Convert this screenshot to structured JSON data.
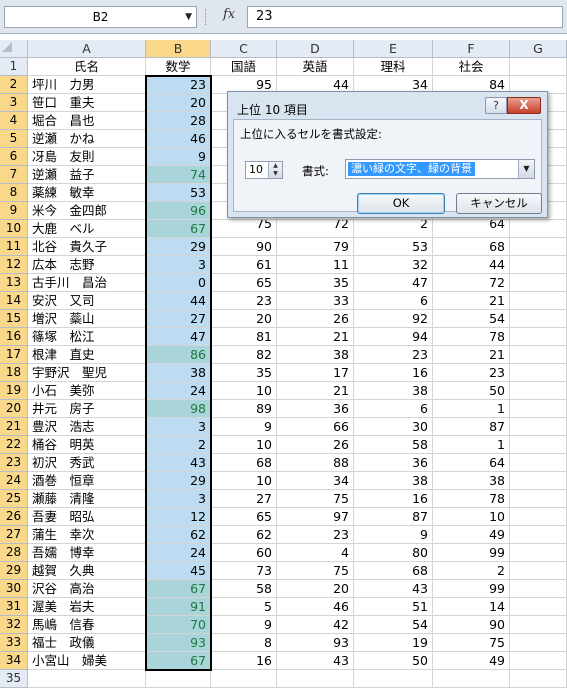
{
  "formula_bar": {
    "name_box": "B2",
    "fx_label": "fx",
    "formula": "23"
  },
  "columns": [
    "A",
    "B",
    "C",
    "D",
    "E",
    "F",
    "G"
  ],
  "headers": [
    "氏名",
    "数学",
    "国語",
    "英語",
    "理科",
    "社会"
  ],
  "rows": [
    {
      "num": "2",
      "name": "坪川　力男",
      "b": "23",
      "c": "95",
      "d": "44",
      "e": "34",
      "f": "84",
      "top": false
    },
    {
      "num": "3",
      "name": "笹口　重夫",
      "b": "20",
      "c": "",
      "d": "",
      "e": "",
      "f": "",
      "top": false
    },
    {
      "num": "4",
      "name": "堀合　昌也",
      "b": "28",
      "c": "",
      "d": "",
      "e": "",
      "f": "",
      "top": false
    },
    {
      "num": "5",
      "name": "逆瀬　かね",
      "b": "46",
      "c": "",
      "d": "",
      "e": "",
      "f": "",
      "top": false
    },
    {
      "num": "6",
      "name": "冴島　友則",
      "b": "9",
      "c": "",
      "d": "",
      "e": "",
      "f": "",
      "top": false
    },
    {
      "num": "7",
      "name": "逆瀬　益子",
      "b": "74",
      "c": "",
      "d": "",
      "e": "",
      "f": "",
      "top": true
    },
    {
      "num": "8",
      "name": "薬練　敏幸",
      "b": "53",
      "c": "",
      "d": "",
      "e": "",
      "f": "",
      "top": false
    },
    {
      "num": "9",
      "name": "米今　金四郎",
      "b": "96",
      "c": "",
      "d": "",
      "e": "",
      "f": "",
      "top": true
    },
    {
      "num": "10",
      "name": "大鹿　ベル",
      "b": "67",
      "c": "",
      "d": "",
      "e": "",
      "f": "",
      "top": true
    },
    {
      "num": "11",
      "name": "北谷　貴久子",
      "b": "29",
      "c": "90",
      "d": "79",
      "e": "53",
      "f": "68",
      "top": false
    },
    {
      "num": "12",
      "name": "広本　志野",
      "b": "3",
      "c": "61",
      "d": "11",
      "e": "32",
      "f": "44",
      "top": false
    },
    {
      "num": "13",
      "name": "古手川　昌治",
      "b": "0",
      "c": "65",
      "d": "35",
      "e": "47",
      "f": "72",
      "top": false
    },
    {
      "num": "14",
      "name": "安沢　又司",
      "b": "44",
      "c": "23",
      "d": "33",
      "e": "6",
      "f": "21",
      "top": false
    },
    {
      "num": "15",
      "name": "増沢　蘂山",
      "b": "27",
      "c": "20",
      "d": "26",
      "e": "92",
      "f": "54",
      "top": false
    },
    {
      "num": "16",
      "name": "篠塚　松江",
      "b": "47",
      "c": "81",
      "d": "21",
      "e": "94",
      "f": "78",
      "top": false
    },
    {
      "num": "17",
      "name": "根津　直史",
      "b": "86",
      "c": "82",
      "d": "38",
      "e": "23",
      "f": "21",
      "top": true
    },
    {
      "num": "18",
      "name": "宇野沢　聖児",
      "b": "38",
      "c": "35",
      "d": "17",
      "e": "16",
      "f": "23",
      "top": false
    },
    {
      "num": "19",
      "name": "小石　美弥",
      "b": "24",
      "c": "10",
      "d": "21",
      "e": "38",
      "f": "50",
      "top": false
    },
    {
      "num": "20",
      "name": "井元　房子",
      "b": "98",
      "c": "89",
      "d": "36",
      "e": "6",
      "f": "1",
      "top": true
    },
    {
      "num": "21",
      "name": "豊沢　浩志",
      "b": "3",
      "c": "9",
      "d": "66",
      "e": "30",
      "f": "87",
      "top": false
    },
    {
      "num": "22",
      "name": "桶谷　明英",
      "b": "2",
      "c": "10",
      "d": "26",
      "e": "58",
      "f": "1",
      "top": false
    },
    {
      "num": "23",
      "name": "初沢　秀武",
      "b": "43",
      "c": "68",
      "d": "88",
      "e": "36",
      "f": "64",
      "top": false
    },
    {
      "num": "24",
      "name": "酒巻　恒章",
      "b": "29",
      "c": "10",
      "d": "34",
      "e": "38",
      "f": "38",
      "top": false
    },
    {
      "num": "25",
      "name": "瀬藤　清隆",
      "b": "3",
      "c": "27",
      "d": "75",
      "e": "16",
      "f": "78",
      "top": false
    },
    {
      "num": "26",
      "name": "吾妻　昭弘",
      "b": "12",
      "c": "65",
      "d": "97",
      "e": "87",
      "f": "10",
      "top": false
    },
    {
      "num": "27",
      "name": "蒲生　幸次",
      "b": "62",
      "c": "62",
      "d": "23",
      "e": "9",
      "f": "49",
      "top": false
    },
    {
      "num": "28",
      "name": "吾嬬　博幸",
      "b": "24",
      "c": "60",
      "d": "4",
      "e": "80",
      "f": "99",
      "top": false
    },
    {
      "num": "29",
      "name": "越賀　久典",
      "b": "45",
      "c": "73",
      "d": "75",
      "e": "68",
      "f": "2",
      "top": false
    },
    {
      "num": "30",
      "name": "沢谷　高治",
      "b": "67",
      "c": "58",
      "d": "20",
      "e": "43",
      "f": "99",
      "top": true
    },
    {
      "num": "31",
      "name": "渥美　岩夫",
      "b": "91",
      "c": "5",
      "d": "46",
      "e": "51",
      "f": "14",
      "top": true
    },
    {
      "num": "32",
      "name": "馬嶋　信春",
      "b": "70",
      "c": "9",
      "d": "42",
      "e": "54",
      "f": "90",
      "top": true
    },
    {
      "num": "33",
      "name": "福士　政儀",
      "b": "93",
      "c": "8",
      "d": "93",
      "e": "19",
      "f": "75",
      "top": true
    },
    {
      "num": "34",
      "name": "小宮山　婦美",
      "b": "67",
      "c": "16",
      "d": "43",
      "e": "50",
      "f": "49",
      "top": true
    }
  ],
  "last_row_num": "35",
  "partial_row10": {
    "c": "75",
    "d": "72",
    "e": "2",
    "f": "64"
  },
  "dialog": {
    "title": "上位 10 項目",
    "help": "?",
    "close": "X",
    "instruction": "上位に入るセルを書式設定:",
    "count": "10",
    "format_label": "書式:",
    "format_value": "濃い緑の文字、緑の背景",
    "ok": "OK",
    "cancel": "キャンセル"
  },
  "colors": {
    "top_fill": "#a9d5da",
    "top_text": "#1c7a3e",
    "selected_range": "#bddcf2",
    "header_selected": "#f9d88a"
  }
}
